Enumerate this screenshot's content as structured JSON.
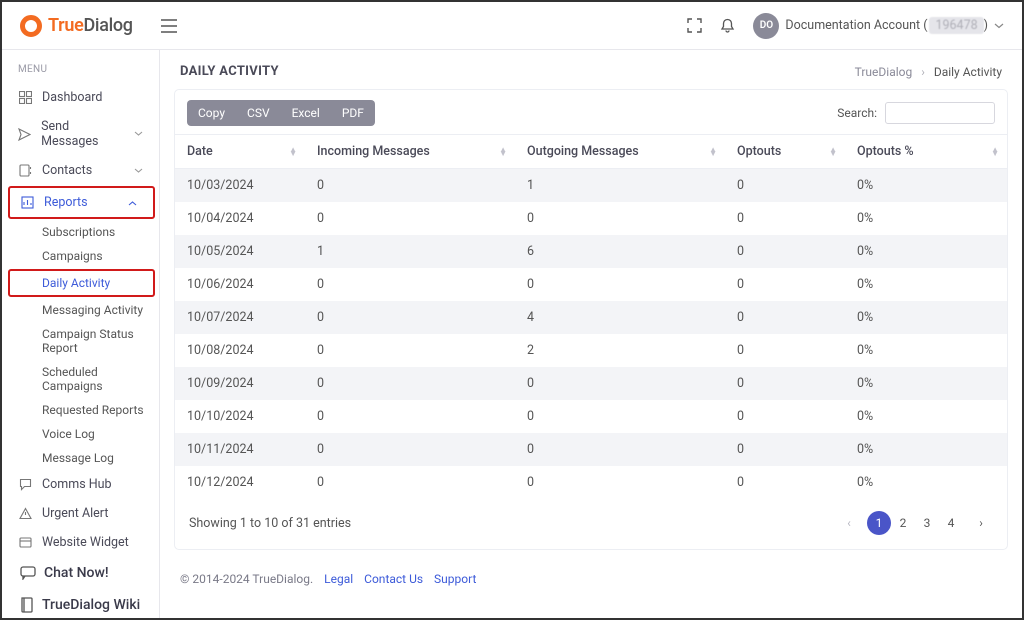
{
  "logo": {
    "brand1": "True",
    "brand2": "Dialog"
  },
  "account": {
    "initials": "DO",
    "name": "Documentation Account",
    "id": "196478"
  },
  "sidebar": {
    "menuLabel": "MENU",
    "dashboard": "Dashboard",
    "sendMessages": "Send Messages",
    "contacts": "Contacts",
    "reports": "Reports",
    "reportsChildren": {
      "subscriptions": "Subscriptions",
      "campaigns": "Campaigns",
      "dailyActivity": "Daily Activity",
      "messagingActivity": "Messaging Activity",
      "campaignStatus": "Campaign Status Report",
      "scheduledCampaigns": "Scheduled Campaigns",
      "requestedReports": "Requested Reports",
      "voiceLog": "Voice Log",
      "messageLog": "Message Log"
    },
    "commsHub": "Comms Hub",
    "urgentAlert": "Urgent Alert",
    "websiteWidget": "Website Widget",
    "chatNow": "Chat Now!",
    "wiki": "TrueDialog Wiki"
  },
  "page": {
    "title": "DAILY ACTIVITY",
    "breadcrumb": {
      "root": "TrueDialog",
      "current": "Daily Activity"
    }
  },
  "toolbar": {
    "copy": "Copy",
    "csv": "CSV",
    "excel": "Excel",
    "pdf": "PDF"
  },
  "search": {
    "label": "Search:",
    "placeholder": ""
  },
  "table": {
    "columns": {
      "date": "Date",
      "incoming": "Incoming Messages",
      "outgoing": "Outgoing Messages",
      "optouts": "Optouts",
      "optoutsPct": "Optouts %"
    },
    "rows": [
      {
        "date": "10/03/2024",
        "incoming": "0",
        "outgoing": "1",
        "optouts": "0",
        "optoutsPct": "0%"
      },
      {
        "date": "10/04/2024",
        "incoming": "0",
        "outgoing": "0",
        "optouts": "0",
        "optoutsPct": "0%"
      },
      {
        "date": "10/05/2024",
        "incoming": "1",
        "outgoing": "6",
        "optouts": "0",
        "optoutsPct": "0%"
      },
      {
        "date": "10/06/2024",
        "incoming": "0",
        "outgoing": "0",
        "optouts": "0",
        "optoutsPct": "0%"
      },
      {
        "date": "10/07/2024",
        "incoming": "0",
        "outgoing": "4",
        "optouts": "0",
        "optoutsPct": "0%"
      },
      {
        "date": "10/08/2024",
        "incoming": "0",
        "outgoing": "2",
        "optouts": "0",
        "optoutsPct": "0%"
      },
      {
        "date": "10/09/2024",
        "incoming": "0",
        "outgoing": "0",
        "optouts": "0",
        "optoutsPct": "0%"
      },
      {
        "date": "10/10/2024",
        "incoming": "0",
        "outgoing": "0",
        "optouts": "0",
        "optoutsPct": "0%"
      },
      {
        "date": "10/11/2024",
        "incoming": "0",
        "outgoing": "0",
        "optouts": "0",
        "optoutsPct": "0%"
      },
      {
        "date": "10/12/2024",
        "incoming": "0",
        "outgoing": "0",
        "optouts": "0",
        "optoutsPct": "0%"
      }
    ],
    "info": "Showing 1 to 10 of 31 entries",
    "pages": [
      "1",
      "2",
      "3",
      "4"
    ]
  },
  "footer": {
    "copy": "© 2014-2024 TrueDialog.",
    "legal": "Legal",
    "contact": "Contact Us",
    "support": "Support"
  }
}
